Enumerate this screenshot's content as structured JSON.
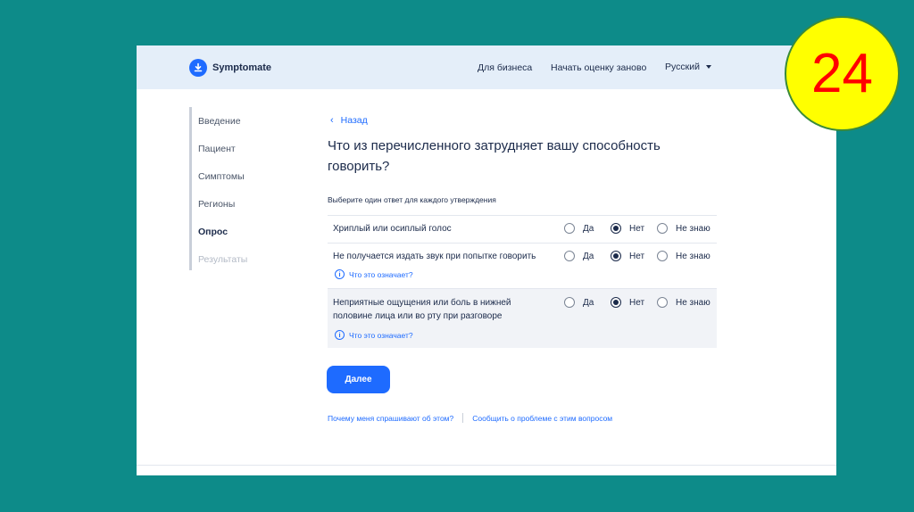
{
  "header": {
    "logo_text": "Symptomate",
    "nav_business": "Для бизнеса",
    "nav_restart": "Начать оценку заново",
    "nav_language": "Русский"
  },
  "sidebar": {
    "items": [
      {
        "label": "Введение",
        "state": "done"
      },
      {
        "label": "Пациент",
        "state": "done"
      },
      {
        "label": "Симптомы",
        "state": "done"
      },
      {
        "label": "Регионы",
        "state": "done"
      },
      {
        "label": "Опрос",
        "state": "active"
      },
      {
        "label": "Результаты",
        "state": "disabled"
      }
    ]
  },
  "main": {
    "back_label": "Назад",
    "question_line1": "Что из перечисленного затрудняет вашу способность",
    "question_line2": "говорить?",
    "instruction": "Выберите один ответ для каждого утверждения",
    "options": [
      "Да",
      "Нет",
      "Не знаю"
    ],
    "rows": [
      {
        "label_line1": "Хриплый или осиплый голос",
        "label_line2": "",
        "selected": "Нет",
        "info": ""
      },
      {
        "label_line1": "Не получается издать звук при попытке говорить",
        "label_line2": "",
        "selected": "Нет",
        "info": "Что это означает?"
      },
      {
        "label_line1": "Неприятные ощущения или боль в нижней",
        "label_line2": "половине лица или во рту при разговоре",
        "selected": "Нет",
        "info": "Что это означает?"
      }
    ],
    "next_label": "Далее",
    "footer_why": "Почему меня спрашивают об этом?",
    "footer_report": "Сообщить о проблеме с этим вопросом"
  },
  "slide_number": "24",
  "colors": {
    "accent": "#1e6bff",
    "header_bg": "#e4eef9",
    "slide_bg": "#0d8b89",
    "badge_bg": "#ffff00",
    "badge_text": "#ff0000"
  }
}
